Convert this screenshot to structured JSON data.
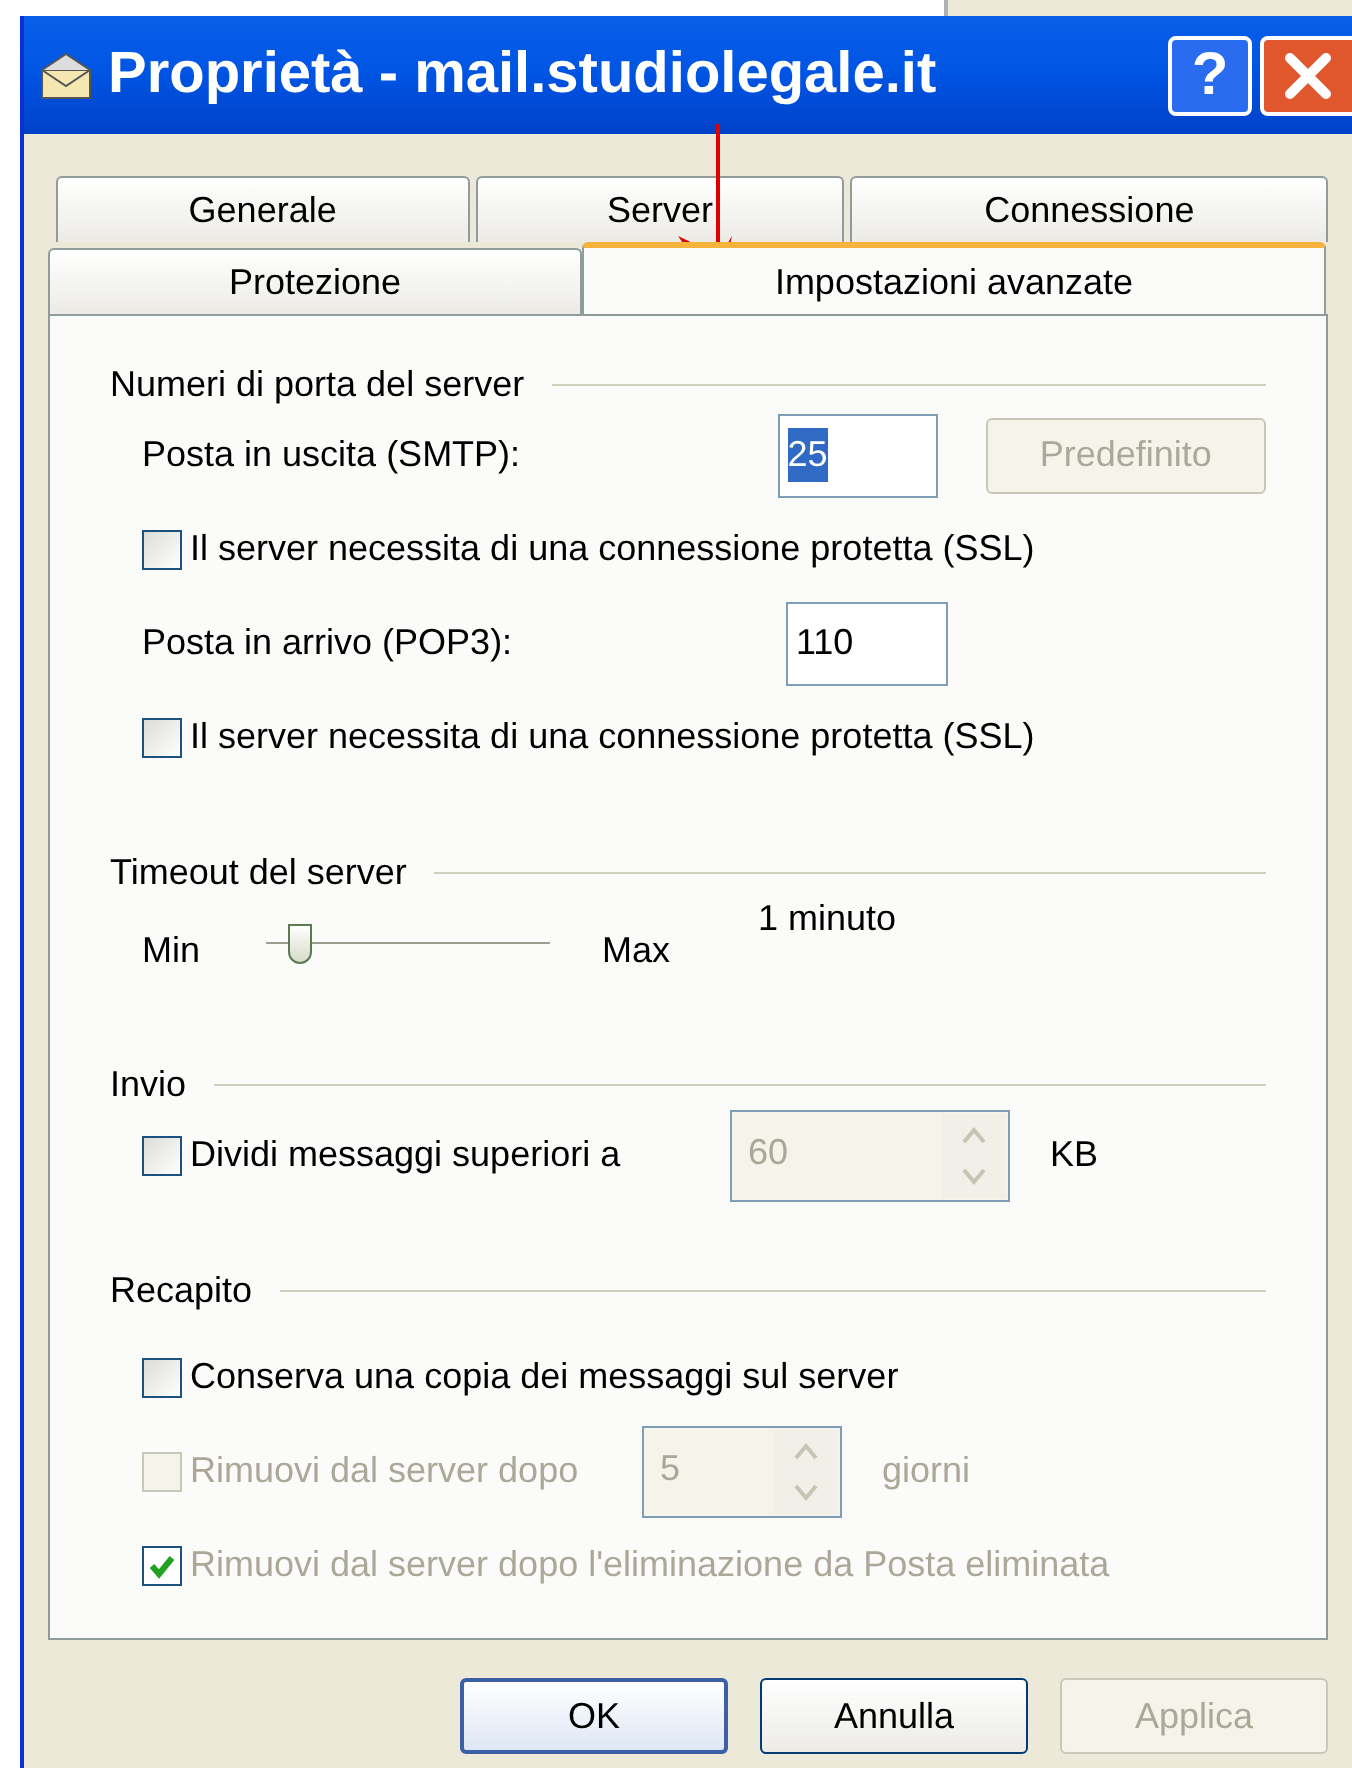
{
  "window": {
    "title": "Proprietà - mail.studiolegale.it"
  },
  "title_buttons": [
    {
      "kind": "help",
      "label": "?"
    },
    {
      "kind": "close"
    }
  ],
  "tab_rows": [
    {
      "tabs": [
        {
          "label": "Generale",
          "selected": false
        },
        {
          "label": "Server",
          "selected": false
        },
        {
          "label": "Connessione",
          "selected": false
        }
      ]
    },
    {
      "tabs": [
        {
          "label": "Protezione",
          "selected": false
        },
        {
          "label": "Impostazioni avanzate",
          "selected": true
        }
      ]
    }
  ],
  "sections": [
    {
      "title": "Numeri di porta del server",
      "items": [
        {
          "kind": "port",
          "label": "Posta in uscita (SMTP):",
          "value": "25",
          "value_selected": true,
          "button": {
            "label": "Predefinito",
            "disabled": true
          }
        },
        {
          "kind": "checkbox",
          "label": "Il server necessita di una connessione protetta (SSL)",
          "checked": false,
          "disabled": false
        },
        {
          "kind": "port",
          "label": "Posta in arrivo (POP3):",
          "value": "110",
          "value_selected": false
        },
        {
          "kind": "checkbox",
          "label": "Il server necessita di una connessione protetta (SSL)",
          "checked": false,
          "disabled": false
        }
      ]
    },
    {
      "title": "Timeout del server",
      "items": [
        {
          "kind": "slider",
          "min_label": "Min",
          "max_label": "Max",
          "level": 0.12,
          "reading": "1 minuto"
        }
      ]
    },
    {
      "title": "Invio",
      "items": [
        {
          "kind": "checkbox_spin",
          "label": "Dividi messaggi superiori a",
          "checked": false,
          "disabled": false,
          "value": "60",
          "spin_disabled": true,
          "unit": "KB"
        }
      ]
    },
    {
      "title": "Recapito",
      "items": [
        {
          "kind": "checkbox",
          "label": "Conserva una copia dei messaggi sul server",
          "checked": false,
          "disabled": false
        },
        {
          "kind": "checkbox_spin",
          "label": "Rimuovi dal server dopo",
          "checked": false,
          "disabled": true,
          "value": "5",
          "spin_disabled": true,
          "unit": "giorni"
        },
        {
          "kind": "checkbox",
          "label": "Rimuovi dal server dopo l'eliminazione da Posta eliminata",
          "checked": true,
          "disabled": true
        }
      ]
    }
  ],
  "buttons": [
    {
      "label": "OK",
      "default": true,
      "disabled": false
    },
    {
      "label": "Annulla",
      "default": false,
      "disabled": false
    },
    {
      "label": "Applica",
      "default": false,
      "disabled": true
    }
  ],
  "annotation": {
    "kind": "arrow"
  }
}
